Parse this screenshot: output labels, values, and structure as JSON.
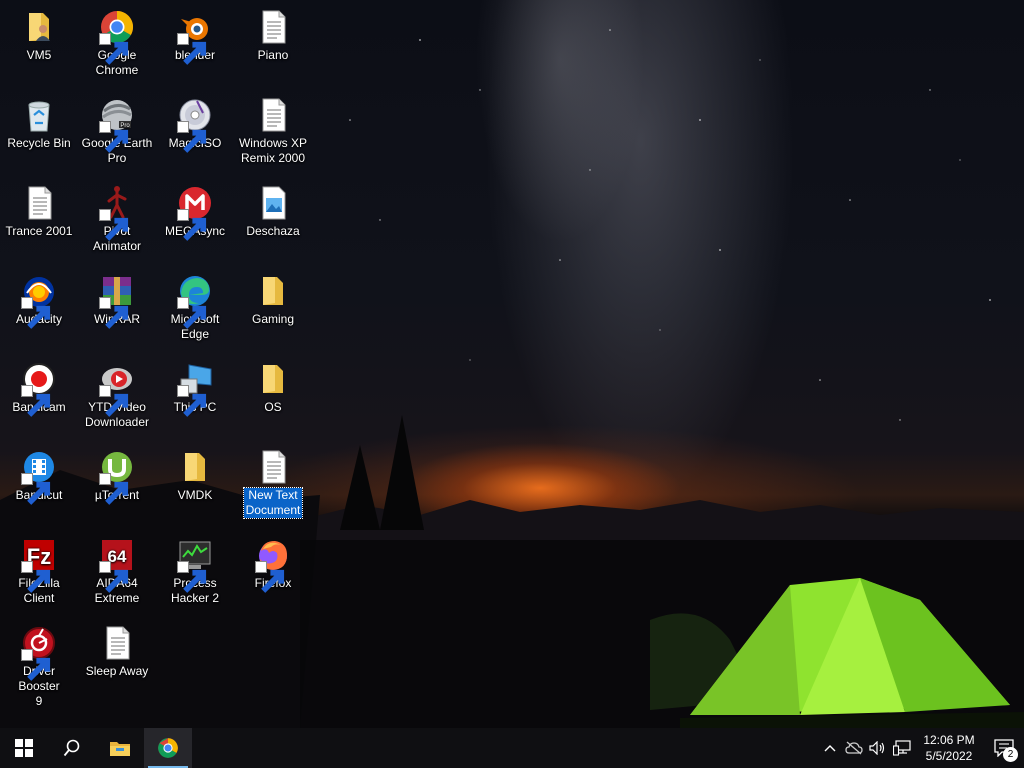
{
  "desktop": {
    "icons": [
      {
        "name": "icon-vm5",
        "label": "VM5",
        "kind": "folder-user"
      },
      {
        "name": "icon-google-chrome",
        "label": "Google\nChrome",
        "kind": "chrome",
        "shortcut": true
      },
      {
        "name": "icon-blender",
        "label": "blender",
        "kind": "blender",
        "shortcut": true
      },
      {
        "name": "icon-piano",
        "label": "Piano",
        "kind": "textdoc"
      },
      {
        "name": "icon-recycle-bin",
        "label": "Recycle Bin",
        "kind": "recycle"
      },
      {
        "name": "icon-google-earth-pro",
        "label": "Google Earth\nPro",
        "kind": "earth",
        "shortcut": true
      },
      {
        "name": "icon-magiciso",
        "label": "MagicISO",
        "kind": "disc",
        "shortcut": true
      },
      {
        "name": "icon-windows-xp-remix-2000",
        "label": "Windows XP\nRemix 2000",
        "kind": "textdoc"
      },
      {
        "name": "icon-trance-2001",
        "label": "Trance 2001",
        "kind": "textdoc"
      },
      {
        "name": "icon-pivot-animator",
        "label": "Pivot\nAnimator",
        "kind": "pivot",
        "shortcut": true
      },
      {
        "name": "icon-megasync",
        "label": "MEGAsync",
        "kind": "mega",
        "shortcut": true
      },
      {
        "name": "icon-deschaza",
        "label": "Deschaza",
        "kind": "imagedoc"
      },
      {
        "name": "icon-audacity",
        "label": "Audacity",
        "kind": "audacity",
        "shortcut": true
      },
      {
        "name": "icon-winrar",
        "label": "WinRAR",
        "kind": "winrar",
        "shortcut": true
      },
      {
        "name": "icon-microsoft-edge",
        "label": "Microsoft\nEdge",
        "kind": "edge",
        "shortcut": true
      },
      {
        "name": "icon-gaming",
        "label": "Gaming",
        "kind": "folder"
      },
      {
        "name": "icon-bandicam",
        "label": "Bandicam",
        "kind": "bandicam",
        "shortcut": true
      },
      {
        "name": "icon-ytd-video-downloader",
        "label": "YTD Video\nDownloader",
        "kind": "ytd",
        "shortcut": true
      },
      {
        "name": "icon-this-pc",
        "label": "This PC",
        "kind": "thispc",
        "shortcut": true
      },
      {
        "name": "icon-os",
        "label": "OS",
        "kind": "folder"
      },
      {
        "name": "icon-bandicut",
        "label": "Bandicut",
        "kind": "bandicut",
        "shortcut": true
      },
      {
        "name": "icon-utorrent",
        "label": "µTorrent",
        "kind": "utorrent",
        "shortcut": true
      },
      {
        "name": "icon-vmdk",
        "label": "VMDK",
        "kind": "folder"
      },
      {
        "name": "icon-new-text-document",
        "label": "New Text\nDocument",
        "kind": "textdoc",
        "selected": true
      },
      {
        "name": "icon-filezilla-client",
        "label": "FileZilla Client",
        "kind": "filezilla",
        "shortcut": true
      },
      {
        "name": "icon-aida64-extreme",
        "label": "AIDA64\nExtreme",
        "kind": "aida",
        "shortcut": true
      },
      {
        "name": "icon-process-hacker-2",
        "label": "Process\nHacker 2",
        "kind": "prochacker",
        "shortcut": true
      },
      {
        "name": "icon-firefox",
        "label": "Firefox",
        "kind": "firefox",
        "shortcut": true
      },
      {
        "name": "icon-driver-booster-9",
        "label": "Driver Booster\n9",
        "kind": "driverbooster",
        "shortcut": true
      },
      {
        "name": "icon-sleep-away",
        "label": "Sleep Away",
        "kind": "textdoc"
      }
    ]
  },
  "taskbar": {
    "clock_time": "12:06 PM",
    "clock_date": "5/5/2022",
    "notification_count": "2"
  }
}
